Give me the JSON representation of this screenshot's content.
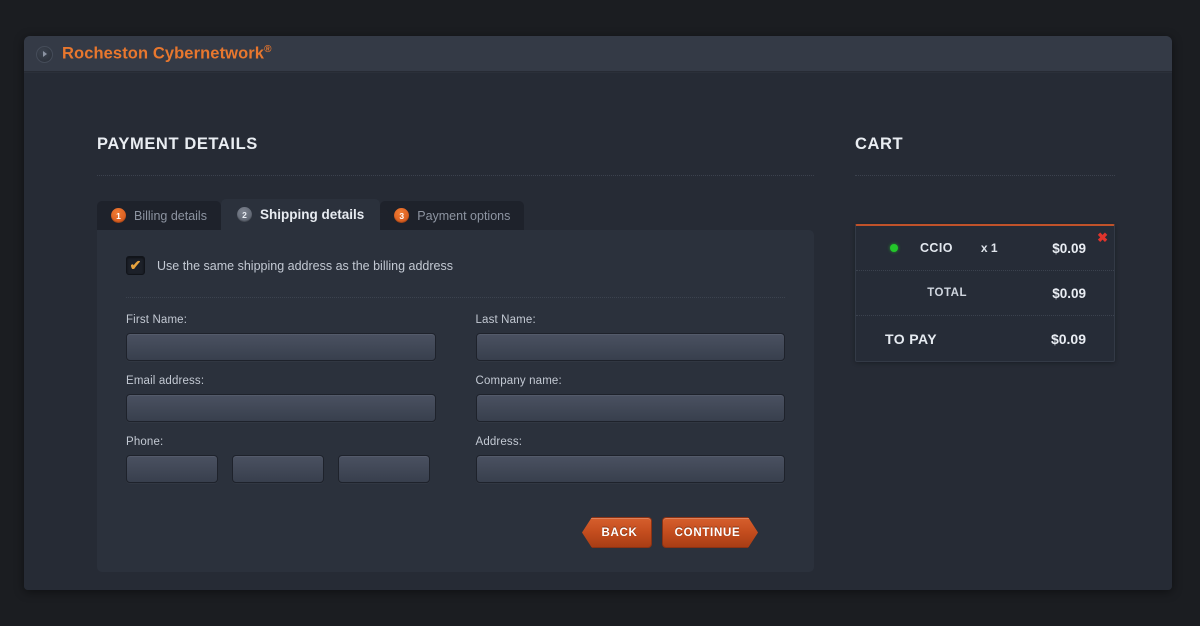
{
  "window": {
    "brand_title": "Rocheston Cybernetwork",
    "brand_trademark": "®",
    "brand_icon": "play-circle-icon"
  },
  "main": {
    "section_title": "PAYMENT DETAILS",
    "tabs": [
      {
        "number": "1",
        "label": "Billing details",
        "active": false
      },
      {
        "number": "2",
        "label": "Shipping details",
        "active": true
      },
      {
        "number": "3",
        "label": "Payment options",
        "active": false
      }
    ],
    "checkbox": {
      "label": "Use the same shipping address as the billing address",
      "checked": true,
      "mark": "✔"
    },
    "fields": {
      "first_name_label": "First Name:",
      "first_name_value": "",
      "last_name_label": "Last Name:",
      "last_name_value": "",
      "email_label": "Email address:",
      "email_value": "",
      "company_label": "Company name:",
      "company_value": "",
      "phone_label": "Phone:",
      "phone_part1": "",
      "phone_part2": "",
      "phone_part3": "",
      "address_label": "Address:",
      "address_value": ""
    },
    "buttons": {
      "back": "BACK",
      "continue": "CONTINUE"
    }
  },
  "cart": {
    "title": "CART",
    "remove_icon": "close-x-icon",
    "item": {
      "status_dot": "in-stock-dot",
      "name": "CCIO",
      "quantity": "x 1",
      "price": "$0.09"
    },
    "total_label": "TOTAL",
    "total_value": "$0.09",
    "to_pay_label": "TO PAY",
    "to_pay_value": "$0.09"
  },
  "colors": {
    "accent_orange": "#e8772e",
    "button_orange": "#c44d1e",
    "panel_bg": "#2b313c",
    "window_bg": "#262b35",
    "titlebar_bg": "#343a46",
    "remove_red": "#e0342c",
    "status_green": "#23c72a",
    "cart_top_border": "#c0522a"
  }
}
